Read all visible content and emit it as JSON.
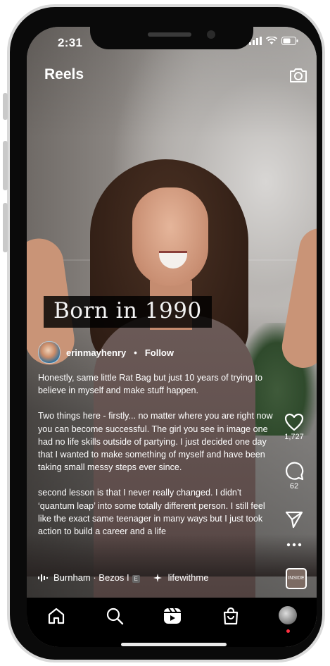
{
  "status_bar": {
    "time": "2:31"
  },
  "header": {
    "title": "Reels",
    "camera_icon": "camera-icon"
  },
  "video_overlay": {
    "caption": "Born in 1990"
  },
  "author": {
    "username": "erinmayhenry",
    "separator": "•",
    "follow_label": "Follow"
  },
  "description": {
    "paragraphs": [
      "Honestly, same little Rat Bag but just 10 years of trying to believe in myself and make stuff happen.",
      "Two things here - firstly... no matter where you are right now you can become successful. The girl you see in image one had no life skills outside of partying. I just decided one day that I wanted to make something of myself and have been taking small messy steps ever since.",
      "second lesson is that I never really changed. I didn’t ‘quantum leap’ into some totally different person. I still feel like the exact same teenager in many ways but I just took action to build a career and a life"
    ]
  },
  "music": {
    "track": "Burnham · Bezos I",
    "badge": "E",
    "tag": "lifewithme"
  },
  "actions": {
    "likes": "1,727",
    "comments": "62"
  },
  "thumbnail": {
    "label": "INSIDE"
  },
  "colors": {
    "background": "#000000",
    "text": "#ffffff",
    "notification_dot": "#ff3040"
  }
}
